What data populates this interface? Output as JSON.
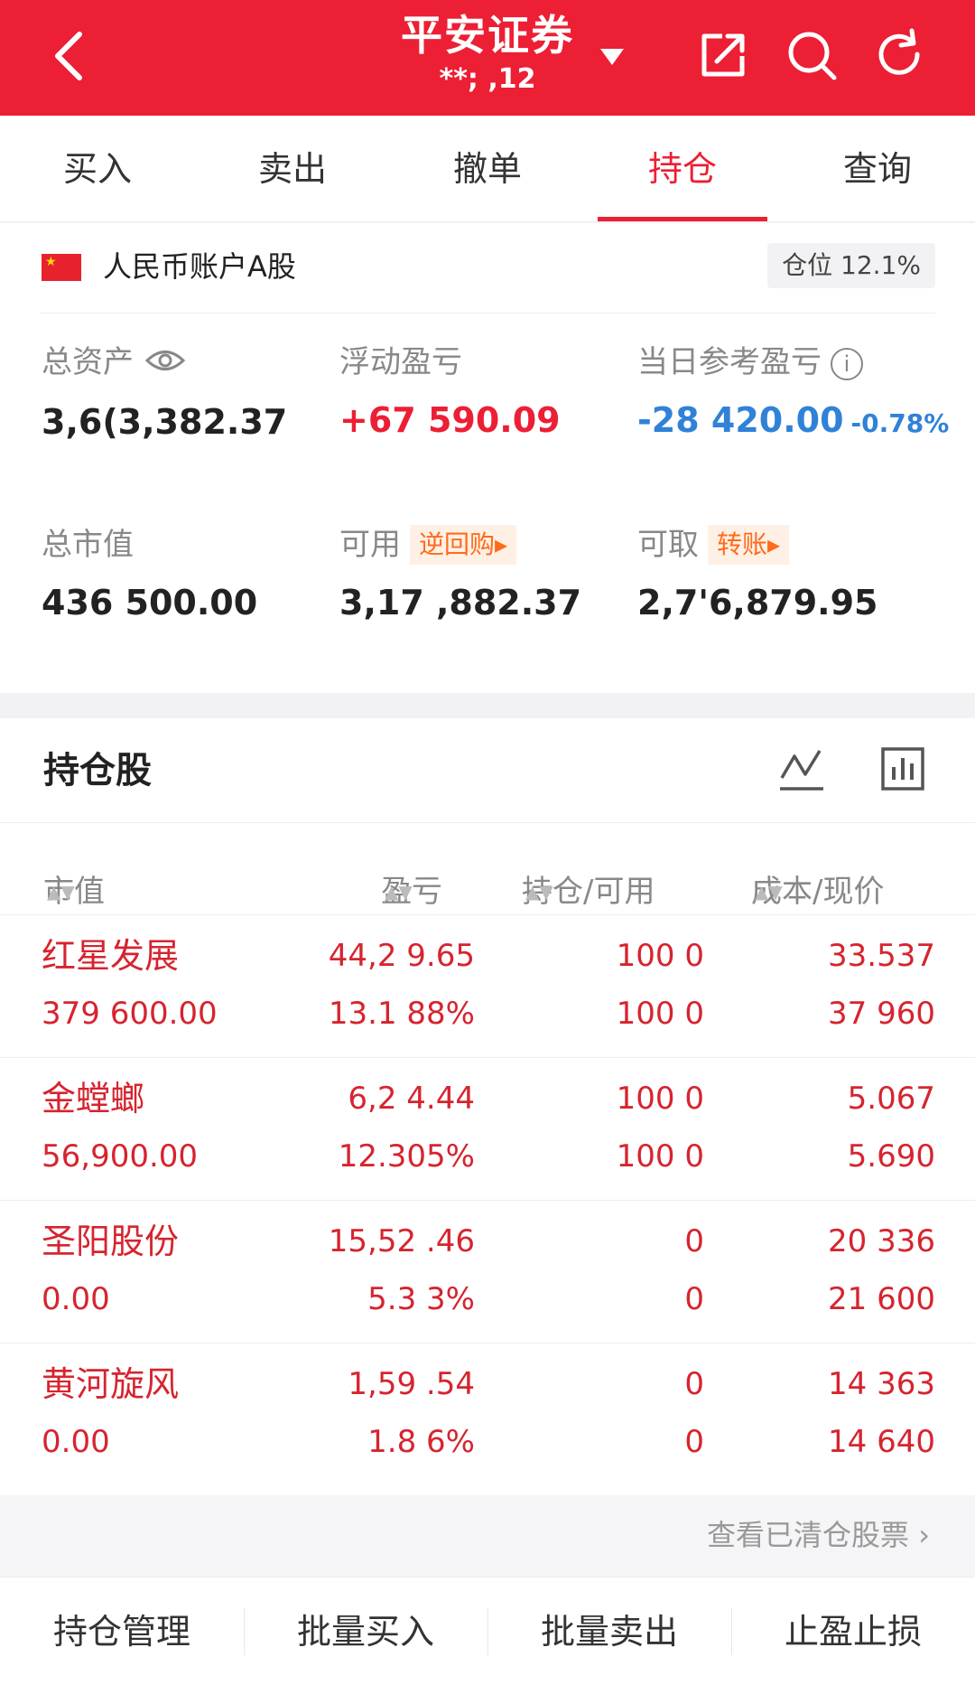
{
  "header": {
    "title": "平安证券",
    "subtitle": "**; ,12",
    "icons": [
      "back-chevron-icon",
      "dropdown-caret-icon",
      "share-icon",
      "search-icon",
      "refresh-icon"
    ]
  },
  "tabs": [
    {
      "label": "买入",
      "active": false
    },
    {
      "label": "卖出",
      "active": false
    },
    {
      "label": "撤单",
      "active": false
    },
    {
      "label": "持仓",
      "active": true
    },
    {
      "label": "查询",
      "active": false
    }
  ],
  "account": {
    "label": "人民币账户A股",
    "position_badge": "仓位 12.1%",
    "total_assets_label": "总资产",
    "total_assets": "3,6(3,382.37",
    "float_pl_label": "浮动盈亏",
    "float_pl": "+67 590.09",
    "today_pl_label": "当日参考盈亏",
    "today_pl": "-28 420.00",
    "today_pl_pct": "-0.78%",
    "market_value_label": "总市值",
    "market_value": "436 500.00",
    "available_label": "可用",
    "available_tag": "逆回购▸",
    "available": "3,17 ,882.37",
    "withdrawable_label": "可取",
    "withdrawable_tag": "转账▸",
    "withdrawable": "2,7'6,879.95"
  },
  "holdings": {
    "title": "持仓股",
    "columns": [
      "市值",
      "盈亏",
      "持仓/可用",
      "成本/现价"
    ],
    "sort_glyph": "▲▼",
    "rows": [
      {
        "name": "红星发展",
        "market_value": "379 600.00",
        "pl": "44,2 9.65",
        "pl_pct": "13.1 88%",
        "position": "100 0",
        "available": "100 0",
        "cost": "33.537",
        "price": "37 960"
      },
      {
        "name": "金螳螂",
        "market_value": "56,900.00",
        "pl": "6,2 4.44",
        "pl_pct": "12.305%",
        "position": "100 0",
        "available": "100 0",
        "cost": "5.067",
        "price": "5.690"
      },
      {
        "name": "圣阳股份",
        "market_value": "0.00",
        "pl": "15,52 .46",
        "pl_pct": "5.3 3%",
        "position": "0",
        "available": "0",
        "cost": "20 336",
        "price": "21 600"
      },
      {
        "name": "黄河旋风",
        "market_value": "0.00",
        "pl": "1,59 .54",
        "pl_pct": "1.8 6%",
        "position": "0",
        "available": "0",
        "cost": "14 363",
        "price": "14 640"
      }
    ]
  },
  "cleared_link": "查看已清仓股票 ›",
  "bottom_bar": [
    "持仓管理",
    "批量买入",
    "批量卖出",
    "止盈止损"
  ],
  "colors": {
    "brand_red": "#ec1f34",
    "stock_red": "#d6242f",
    "loss_blue": "#2f82d8",
    "tag_orange": "#ff6b1a"
  }
}
